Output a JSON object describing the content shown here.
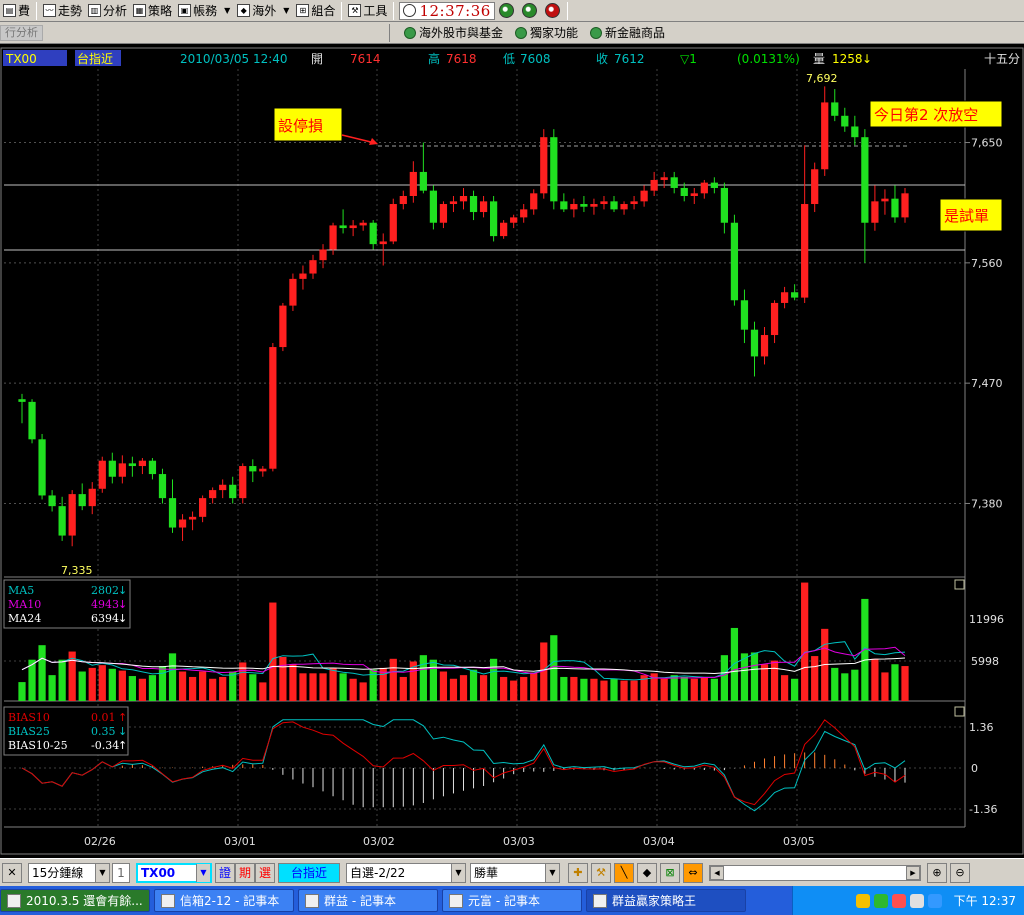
{
  "toolbar": {
    "items": [
      {
        "label": "費",
        "icon": "report-icon"
      },
      {
        "label": "走勢",
        "icon": "trend-chart-icon"
      },
      {
        "label": "分析",
        "icon": "bar-chart-icon"
      },
      {
        "label": "策略",
        "icon": "strategy-icon"
      },
      {
        "label": "帳務",
        "icon": "account-icon"
      },
      {
        "label": "海外",
        "icon": "overseas-icon"
      },
      {
        "label": "組合",
        "icon": "portfolio-icon"
      },
      {
        "label": "工具",
        "icon": "tools-icon"
      }
    ],
    "clock": "12:37:36"
  },
  "bar2": {
    "tab": "行分析",
    "links": [
      "海外股市與基金",
      "獨家功能",
      "新金融商品"
    ]
  },
  "header": {
    "symbol": "TX00",
    "name": "台指近",
    "datetime": "2010/03/05 12:40",
    "open_label": "開",
    "open": "7614",
    "high_label": "高",
    "high": "7618",
    "low_label": "低",
    "low": "7608",
    "close_label": "收",
    "close": "7612",
    "change": "▽1",
    "change_pct": "(0.0131%)",
    "volume_label": "量",
    "volume": "1258",
    "period": "十五分"
  },
  "annotations": {
    "stop_loss": "設停損",
    "short_note": "今日第2 次放空",
    "test_order": "是試單",
    "high_mark": "7,692",
    "low_mark": "7,335"
  },
  "chart_data": {
    "type": "candlestick",
    "price_axis": {
      "ticks": [
        "7,650",
        "7,560",
        "7,470",
        "7,380"
      ],
      "range": [
        7325,
        7705
      ]
    },
    "date_labels": [
      "02/26",
      "03/01",
      "03/02",
      "03/03",
      "03/04",
      "03/05"
    ],
    "volume_legend": [
      {
        "name": "MA5",
        "value": "2802",
        "color": "#00c0c0"
      },
      {
        "name": "MA10",
        "value": "4943",
        "color": "#e000e0"
      },
      {
        "name": "MA24",
        "value": "6394",
        "color": "#ffffff"
      }
    ],
    "volume_axis": {
      "ticks": [
        "11996",
        "5998"
      ]
    },
    "bias_legend": [
      {
        "name": "BIAS10",
        "value": "0.01",
        "color": "#e00000"
      },
      {
        "name": "BIAS25",
        "value": "0.35",
        "color": "#00c0c0"
      },
      {
        "name": "BIAS10-25",
        "value": "-0.34",
        "color": "#ffffff"
      }
    ],
    "bias_axis": {
      "ticks": [
        "1.36",
        "0",
        "-1.36"
      ]
    },
    "candles": [
      [
        7458,
        7462,
        7440,
        7456
      ],
      [
        7456,
        7458,
        7425,
        7428
      ],
      [
        7428,
        7432,
        7383,
        7386
      ],
      [
        7386,
        7390,
        7374,
        7378
      ],
      [
        7378,
        7385,
        7352,
        7356
      ],
      [
        7356,
        7390,
        7348,
        7387
      ],
      [
        7387,
        7395,
        7375,
        7378
      ],
      [
        7378,
        7396,
        7372,
        7391
      ],
      [
        7391,
        7415,
        7388,
        7412
      ],
      [
        7412,
        7418,
        7395,
        7400
      ],
      [
        7400,
        7416,
        7395,
        7410
      ],
      [
        7410,
        7415,
        7400,
        7408
      ],
      [
        7408,
        7414,
        7402,
        7412
      ],
      [
        7412,
        7414,
        7398,
        7402
      ],
      [
        7402,
        7406,
        7380,
        7384
      ],
      [
        7384,
        7398,
        7358,
        7362
      ],
      [
        7362,
        7372,
        7352,
        7368
      ],
      [
        7368,
        7374,
        7360,
        7370
      ],
      [
        7370,
        7386,
        7366,
        7384
      ],
      [
        7384,
        7392,
        7380,
        7390
      ],
      [
        7390,
        7398,
        7384,
        7394
      ],
      [
        7394,
        7400,
        7380,
        7384
      ],
      [
        7384,
        7410,
        7380,
        7408
      ],
      [
        7408,
        7413,
        7396,
        7404
      ],
      [
        7404,
        7408,
        7400,
        7406
      ],
      [
        7406,
        7500,
        7404,
        7497
      ],
      [
        7497,
        7530,
        7494,
        7528
      ],
      [
        7528,
        7552,
        7524,
        7548
      ],
      [
        7548,
        7558,
        7540,
        7552
      ],
      [
        7552,
        7566,
        7548,
        7562
      ],
      [
        7562,
        7574,
        7556,
        7570
      ],
      [
        7570,
        7590,
        7566,
        7588
      ],
      [
        7588,
        7600,
        7582,
        7586
      ],
      [
        7586,
        7592,
        7580,
        7588
      ],
      [
        7588,
        7592,
        7584,
        7590
      ],
      [
        7590,
        7592,
        7570,
        7574
      ],
      [
        7574,
        7582,
        7558,
        7576
      ],
      [
        7576,
        7608,
        7574,
        7604
      ],
      [
        7604,
        7614,
        7600,
        7610
      ],
      [
        7610,
        7636,
        7605,
        7628
      ],
      [
        7628,
        7650,
        7612,
        7614
      ],
      [
        7614,
        7618,
        7585,
        7590
      ],
      [
        7590,
        7606,
        7586,
        7604
      ],
      [
        7604,
        7610,
        7598,
        7606
      ],
      [
        7606,
        7616,
        7600,
        7610
      ],
      [
        7610,
        7614,
        7592,
        7598
      ],
      [
        7598,
        7610,
        7594,
        7606
      ],
      [
        7606,
        7610,
        7576,
        7580
      ],
      [
        7580,
        7592,
        7578,
        7590
      ],
      [
        7590,
        7596,
        7586,
        7594
      ],
      [
        7594,
        7604,
        7590,
        7600
      ],
      [
        7600,
        7615,
        7596,
        7612
      ],
      [
        7612,
        7660,
        7608,
        7654
      ],
      [
        7654,
        7660,
        7600,
        7606
      ],
      [
        7606,
        7612,
        7598,
        7600
      ],
      [
        7600,
        7608,
        7594,
        7604
      ],
      [
        7604,
        7610,
        7598,
        7602
      ],
      [
        7602,
        7608,
        7596,
        7604
      ],
      [
        7604,
        7610,
        7600,
        7606
      ],
      [
        7606,
        7610,
        7598,
        7600
      ],
      [
        7600,
        7606,
        7596,
        7604
      ],
      [
        7604,
        7610,
        7600,
        7606
      ],
      [
        7606,
        7618,
        7602,
        7614
      ],
      [
        7614,
        7628,
        7610,
        7622
      ],
      [
        7622,
        7628,
        7616,
        7624
      ],
      [
        7624,
        7628,
        7612,
        7616
      ],
      [
        7616,
        7620,
        7606,
        7610
      ],
      [
        7610,
        7616,
        7604,
        7612
      ],
      [
        7612,
        7622,
        7608,
        7620
      ],
      [
        7620,
        7624,
        7612,
        7616
      ],
      [
        7616,
        7620,
        7582,
        7590
      ],
      [
        7590,
        7596,
        7528,
        7532
      ],
      [
        7532,
        7540,
        7500,
        7510
      ],
      [
        7510,
        7516,
        7475,
        7490
      ],
      [
        7490,
        7512,
        7484,
        7506
      ],
      [
        7506,
        7532,
        7500,
        7530
      ],
      [
        7530,
        7542,
        7526,
        7538
      ],
      [
        7538,
        7544,
        7532,
        7534
      ],
      [
        7534,
        7648,
        7530,
        7604
      ],
      [
        7604,
        7635,
        7598,
        7630
      ],
      [
        7630,
        7692,
        7625,
        7680
      ],
      [
        7680,
        7690,
        7666,
        7670
      ],
      [
        7670,
        7676,
        7658,
        7662
      ],
      [
        7662,
        7670,
        7648,
        7654
      ],
      [
        7654,
        7660,
        7560,
        7590
      ],
      [
        7590,
        7618,
        7584,
        7606
      ],
      [
        7606,
        7615,
        7596,
        7608
      ],
      [
        7608,
        7618,
        7590,
        7594
      ],
      [
        7594,
        7616,
        7590,
        7612
      ]
    ]
  },
  "bottombar": {
    "period_select": "15分鍾線",
    "count": "1",
    "symbol_input": "TX00",
    "btn1": "證",
    "btn2": "期",
    "btn3": "選",
    "symbol_name": "台指近",
    "list_select": "自選-2/22",
    "broker_select": "勝華"
  },
  "taskbar": {
    "tasks": [
      "2010.3.5 還會有餘...",
      "信箱2-12 - 記事本",
      "群益 - 記事本",
      "元富 - 記事本",
      "群益贏家策略王"
    ],
    "clock": "下午 12:37"
  }
}
